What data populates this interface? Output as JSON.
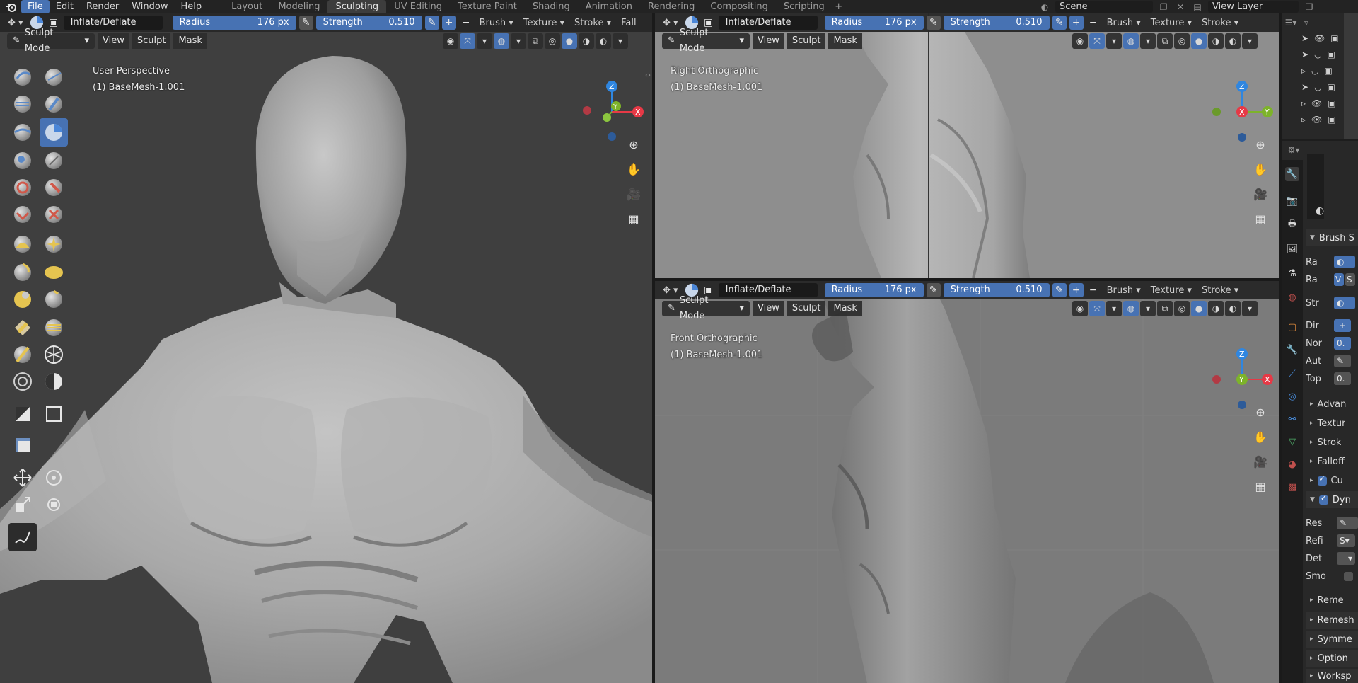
{
  "menu": {
    "file": "File",
    "edit": "Edit",
    "render": "Render",
    "window": "Window",
    "help": "Help"
  },
  "workspace_tabs": [
    "Layout",
    "Modeling",
    "Sculpting",
    "UV Editing",
    "Texture Paint",
    "Shading",
    "Animation",
    "Rendering",
    "Compositing",
    "Scripting"
  ],
  "scene": {
    "label": "Scene",
    "view_layer": "View Layer"
  },
  "tool_header": {
    "brush_name": "Inflate/Deflate",
    "radius_label": "Radius",
    "radius_value": "176 px",
    "strength_label": "Strength",
    "strength_value": "0.510",
    "brush": "Brush",
    "texture": "Texture",
    "stroke": "Stroke",
    "falloff": "Fall"
  },
  "mode_header": {
    "mode": "Sculpt Mode",
    "view": "View",
    "sculpt": "Sculpt",
    "mask": "Mask"
  },
  "viewports": {
    "left": {
      "perspective": "User Perspective",
      "object": "(1) BaseMesh-1.001"
    },
    "right_top": {
      "perspective": "Right Orthographic",
      "object": "(1) BaseMesh-1.001"
    },
    "right_bottom": {
      "perspective": "Front Orthographic",
      "object": "(1) BaseMesh-1.001"
    }
  },
  "gizmo_axes": {
    "z": "Z",
    "x": "X",
    "y": "Y"
  },
  "properties": {
    "brush_settings": "Brush S",
    "radius_row1": "Ra",
    "radius_row2": "Ra",
    "radius_v": "V",
    "radius_s": "S",
    "strength_row": "Str",
    "direction": "Dir",
    "normal_radius": "Nor",
    "normal_value": "0.",
    "autosmooth": "Aut",
    "topology": "Top",
    "topology_value": "0.",
    "advanced": "Advan",
    "texture": "Textur",
    "stroke": "Strok",
    "falloff": "Falloff",
    "cursor": "Cu",
    "dyntopo": "Dyn",
    "resolution": "Res",
    "refine": "Refi",
    "refine_value": "S",
    "detailing": "Det",
    "smooth_shading": "Smo",
    "remesh_sub": "Reme",
    "remesh": "Remesh",
    "symmetry": "Symme",
    "options": "Option",
    "workspace": "Worksp"
  },
  "colors": {
    "accent": "#4772b3",
    "axis_x": "#e63946",
    "axis_y": "#7db32a",
    "axis_z": "#2f86e0"
  }
}
